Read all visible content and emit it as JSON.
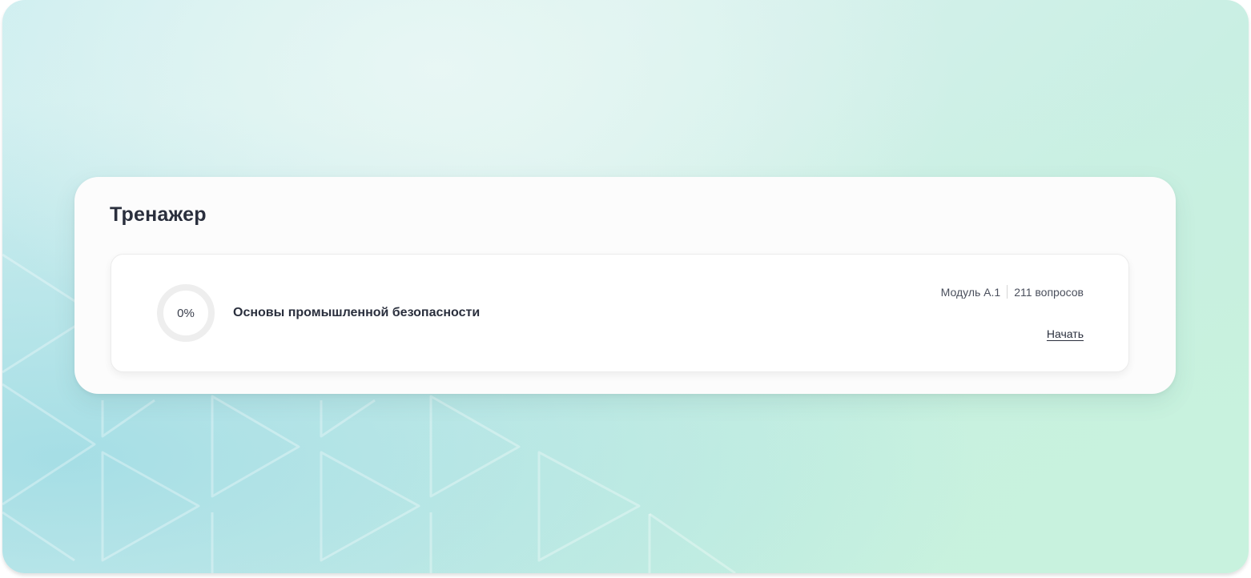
{
  "section": {
    "title": "Тренажер"
  },
  "course": {
    "progress": "0%",
    "progress_value": 0,
    "title": "Основы промышленной безопасности",
    "module": "Модуль А.1",
    "questions": "211 вопросов",
    "start_label": "Начать"
  },
  "theme": {
    "text_dark": "#2a2f3d",
    "ring_track": "#eeeeee",
    "card_bg": "#fcfcfc"
  }
}
